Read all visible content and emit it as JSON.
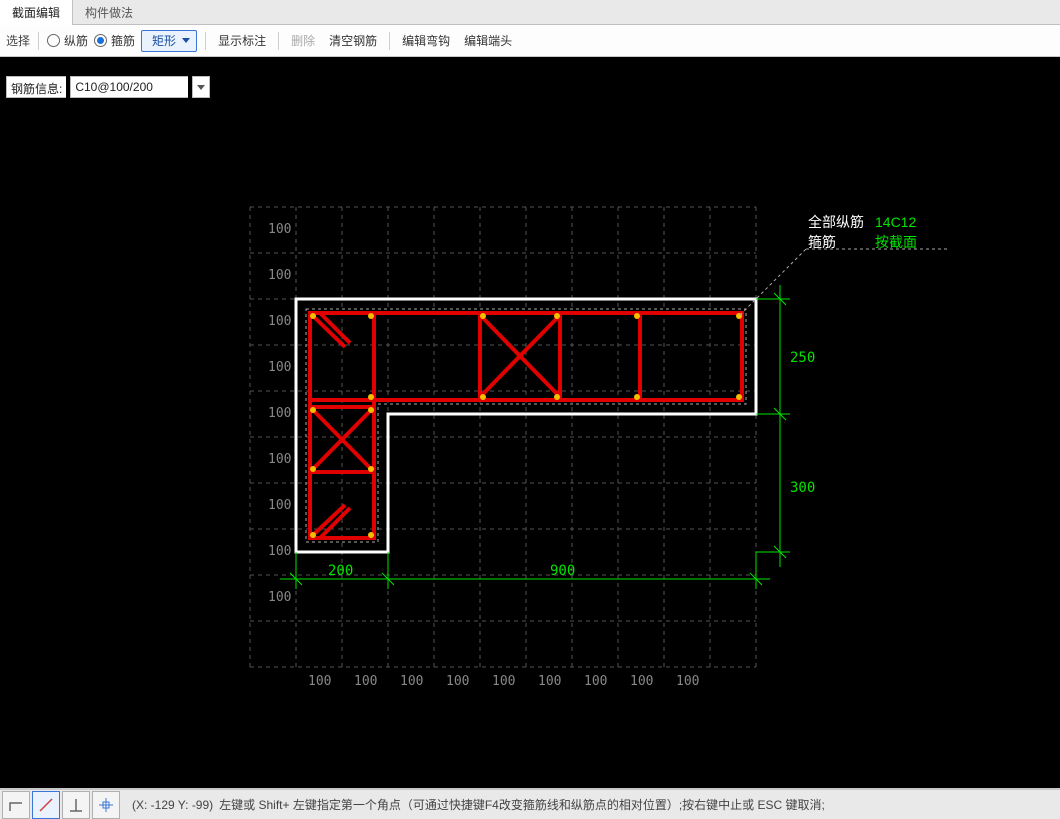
{
  "tabs": {
    "active": "截面编辑",
    "other": "构件做法"
  },
  "toolbar": {
    "select": "选择",
    "radio1": "纵筋",
    "radio2": "箍筋",
    "shape": "矩形",
    "showLabel": "显示标注",
    "delete": "删除",
    "clear": "清空钢筋",
    "editHook": "编辑弯钩",
    "editEnd": "编辑端头"
  },
  "info": {
    "label": "钢筋信息:",
    "value": "C10@100/200"
  },
  "gridRows": [
    "100",
    "100",
    "100",
    "100",
    "100",
    "100",
    "100",
    "100",
    "100"
  ],
  "gridColsBottom": [
    "100",
    "100",
    "100",
    "100",
    "100",
    "100",
    "100",
    "100",
    "100"
  ],
  "dims": {
    "w1": "200",
    "w2": "900",
    "h1": "250",
    "h2": "300"
  },
  "anno": {
    "line1a": "全部纵筋",
    "line1b": "14C12",
    "line2a": "箍筋",
    "line2b": "按截面"
  },
  "status": {
    "coords": "(X: -129 Y: -99)",
    "hint": "左键或 Shift+ 左键指定第一个角点（可通过快捷键F4改变箍筋线和纵筋点的相对位置）;按右键中止或 ESC 键取消;"
  }
}
